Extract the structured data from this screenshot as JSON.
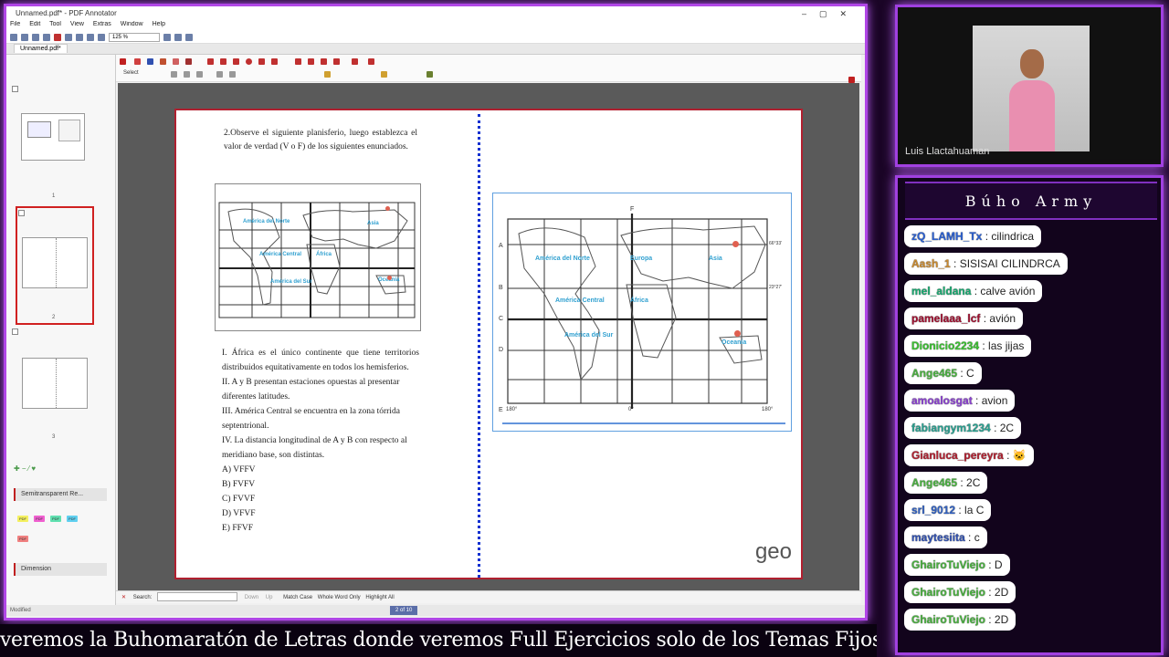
{
  "window": {
    "title": "Unnamed.pdf* - PDF Annotator",
    "menu": [
      "File",
      "Edit",
      "Tool",
      "View",
      "Extras",
      "Window",
      "Help"
    ],
    "zoom": "125 %",
    "tab": "Unnamed.pdf*",
    "tool_label": "Select"
  },
  "thumbnails": {
    "pages": [
      "1",
      "2",
      "3"
    ]
  },
  "properties": {
    "pen_style": "Semitransparent Re...",
    "dimension": "Dimension",
    "status": "Modified"
  },
  "question": {
    "prompt": "2.Observe el siguiente planisferio, luego establezca el valor de verdad (V o F) de los siguientes enunciados.",
    "statements": [
      "I. África es el único continente que tiene territorios distribuidos equitativamente en todos los hemisferios.",
      "II. A y B presentan estaciones opuestas al presentar diferentes latitudes.",
      "III. América Central se encuentra en la zona tórrida septentrional.",
      "IV. La distancia longitudinal de A y B con respecto al meridiano base, son distintas."
    ],
    "options": [
      "A) VFFV",
      "B) FVFV",
      "C) FVVF",
      "D) VFVF",
      "E) FFVF"
    ]
  },
  "map_labels": {
    "north_america": "América del Norte",
    "central_america": "América Central",
    "south_america": "América del Sur",
    "europe": "Europa",
    "africa": "África",
    "asia": "Asia",
    "oceania": "Oceanía",
    "row_a": "A",
    "row_b": "B",
    "row_c": "C",
    "row_d": "D",
    "row_e": "E",
    "meridian": "F",
    "lon_left": "180°",
    "lon_center": "0°",
    "lon_right": "180°",
    "lat_66": "66°33'",
    "lat_23": "23°27'"
  },
  "branding": {
    "logo": "geo"
  },
  "findbar": {
    "search_label": "Search:",
    "down": "Down",
    "up": "Up",
    "match_case": "Match Case",
    "whole_word": "Whole Word Only",
    "highlight_all": "Highlight All"
  },
  "pager": "2 of 10",
  "webcam": {
    "name": "Luis Llactahuaman"
  },
  "chat": {
    "title": "Búho Army",
    "messages": [
      {
        "user": "zQ_LAMH_Tx",
        "text": ": cilindrica",
        "color": "#2a5fd0"
      },
      {
        "user": "Aash_1",
        "text": ": SISISAI CILINDRCA",
        "color": "#c98a30"
      },
      {
        "user": "mel_aldana",
        "text": ": calve avión",
        "color": "#1aa870"
      },
      {
        "user": "pamelaaa_lcf",
        "text": ": avión",
        "color": "#a01030"
      },
      {
        "user": "Dionicio2234",
        "text": ": las jijas",
        "color": "#3ac030"
      },
      {
        "user": "Ange465",
        "text": ": C",
        "color": "#4ab040"
      },
      {
        "user": "amoalosgat",
        "text": ": avion",
        "color": "#8a40d0"
      },
      {
        "user": "fabiangym1234",
        "text": ": 2C",
        "color": "#2aa090"
      },
      {
        "user": "Gianluca_pereyra",
        "text": ": 🐱",
        "color": "#b02030"
      },
      {
        "user": "Ange465",
        "text": ": 2C",
        "color": "#4ab040"
      },
      {
        "user": "srl_9012",
        "text": ": la C",
        "color": "#3060c0"
      },
      {
        "user": "maytesiita",
        "text": ": c",
        "color": "#3050b0"
      },
      {
        "user": "GhairoTuViejo",
        "text": ": D",
        "color": "#4ab040"
      },
      {
        "user": "GhairoTuViejo",
        "text": ": 2D",
        "color": "#4ab040"
      },
      {
        "user": "GhairoTuViejo",
        "text": ": 2D",
        "color": "#4ab040"
      }
    ]
  },
  "ticker": "veremos la Buhomaratón de Letras donde veremos Full Ejercicios solo de los Temas Fijos ♡"
}
